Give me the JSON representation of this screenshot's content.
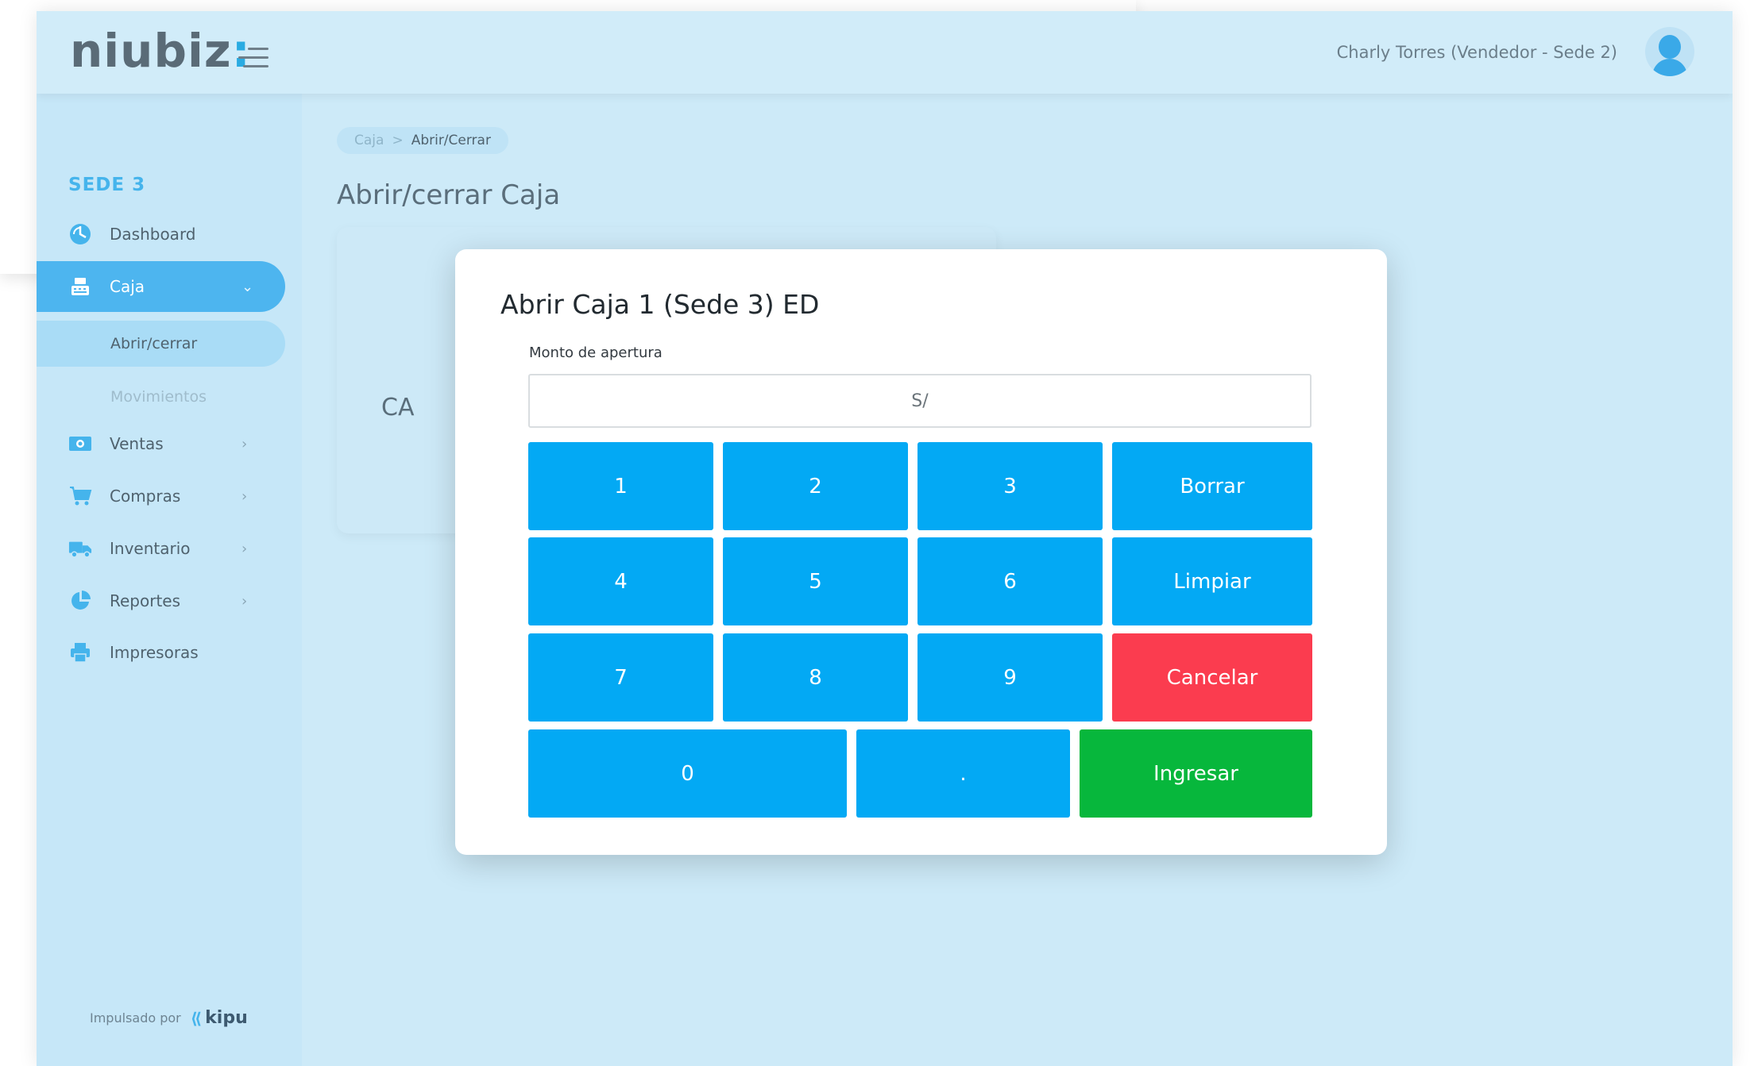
{
  "header": {
    "logo_text": "niubiz",
    "logo_colon": ":",
    "user": "Charly Torres (Vendedor - Sede 2)"
  },
  "sidebar": {
    "sede": "SEDE 3",
    "items": [
      {
        "label": "Dashboard",
        "icon": "dashboard-icon"
      },
      {
        "label": "Caja",
        "icon": "cash-register-icon",
        "chevron": "⌄"
      },
      {
        "label": "Ventas",
        "icon": "money-icon",
        "chevron": "›"
      },
      {
        "label": "Compras",
        "icon": "cart-icon",
        "chevron": "›"
      },
      {
        "label": "Inventario",
        "icon": "truck-icon",
        "chevron": "›"
      },
      {
        "label": "Reportes",
        "icon": "pie-chart-icon",
        "chevron": "›"
      },
      {
        "label": "Impresoras",
        "icon": "printer-icon"
      }
    ],
    "subitems": [
      {
        "label": "Abrir/cerrar"
      },
      {
        "label": "Movimientos"
      }
    ],
    "powered_by": "Impulsado por",
    "powered_brand": "kipu"
  },
  "main": {
    "breadcrumb": {
      "parent": "Caja",
      "separator": ">",
      "current": "Abrir/Cerrar"
    },
    "title": "Abrir/cerrar Caja",
    "card_text": "CA"
  },
  "modal": {
    "title": "Abrir Caja 1 (Sede 3) ED",
    "field_label": "Monto de apertura",
    "field_placeholder": "S/",
    "field_value": "",
    "keys": {
      "k1": "1",
      "k2": "2",
      "k3": "3",
      "k4": "4",
      "k5": "5",
      "k6": "6",
      "k7": "7",
      "k8": "8",
      "k9": "9",
      "k0": "0",
      "kdot": ".",
      "borrar": "Borrar",
      "limpiar": "Limpiar",
      "cancelar": "Cancelar",
      "ingresar": "Ingresar"
    }
  },
  "colors": {
    "key_blue": "#03a9f4",
    "cancel_red": "#fb3c4f",
    "submit_green": "#07b73c",
    "active_nav": "#4db5ef",
    "background": "#cdeaf8"
  }
}
